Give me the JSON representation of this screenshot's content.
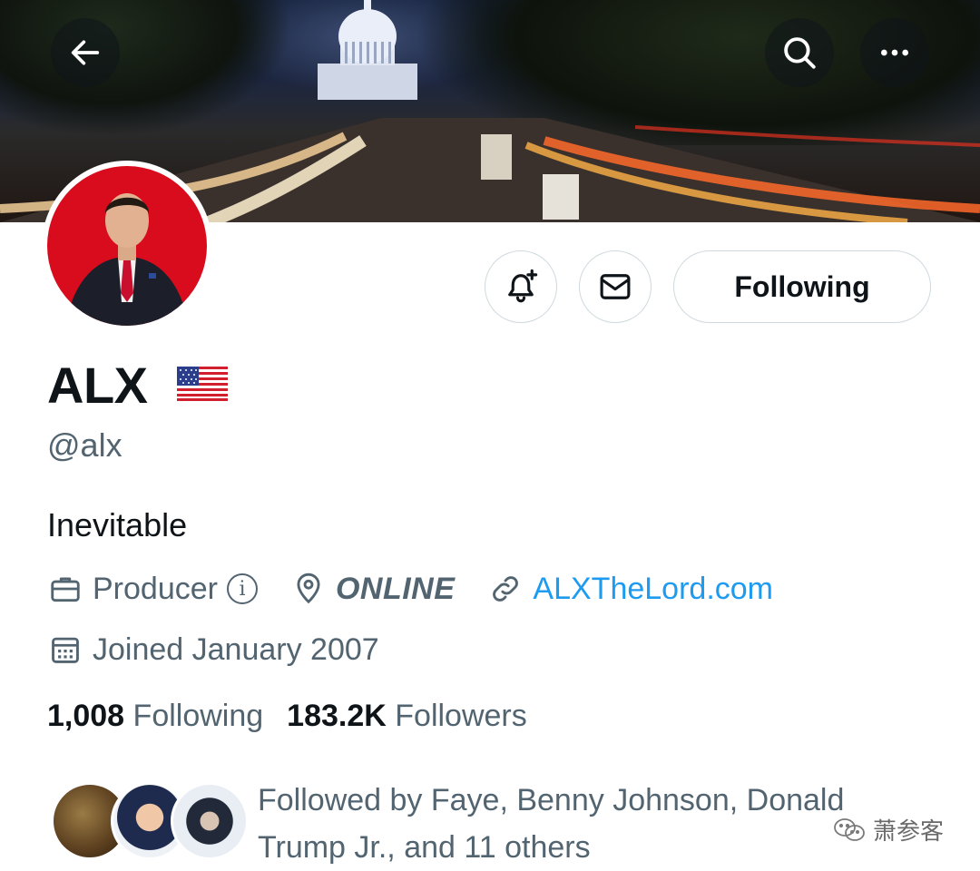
{
  "header": {
    "back_icon": "arrow-left-icon",
    "search_icon": "search-icon",
    "more_icon": "more-horizontal-icon"
  },
  "profile": {
    "display_name": "ALX",
    "flag_emoji": "🇺🇸",
    "handle": "@alx",
    "bio": "Inevitable",
    "profession": "Producer",
    "location": "ONLINE",
    "website": "ALXTheLord.com",
    "joined": "Joined January 2007"
  },
  "actions": {
    "notify_icon": "bell-plus-icon",
    "message_icon": "envelope-icon",
    "following_label": "Following"
  },
  "stats": {
    "following_count": "1,008",
    "following_label": "Following",
    "followers_count": "183.2K",
    "followers_label": "Followers"
  },
  "followed_by": {
    "text": "Followed by Faye, Benny Johnson, Donald Trump Jr., and 11 others"
  },
  "watermark": {
    "text": "萧参客"
  },
  "colors": {
    "accent": "#1d9bf0",
    "secondary_text": "#536471",
    "primary_text": "#0f1419",
    "border": "#cfd9de",
    "avatar_bg": "#d80c1c"
  }
}
